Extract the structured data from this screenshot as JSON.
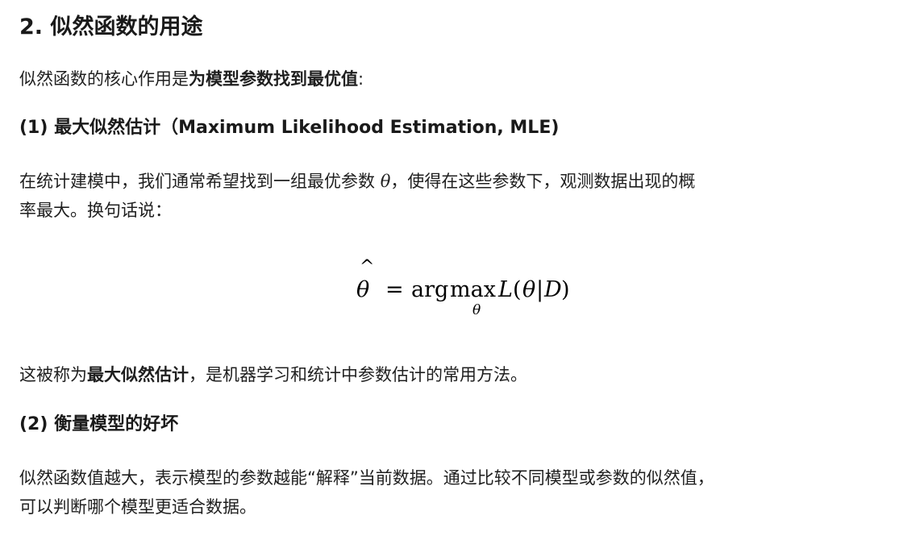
{
  "section_title": "2. 似然函数的用途",
  "intro": {
    "text": "似然函数的核心作用是",
    "bold": "为模型参数找到最优值",
    "colon": ":"
  },
  "subsection1": {
    "title": "(1) 最大似然估计（Maximum Likelihood Estimation, MLE)",
    "para_line1_before": "在统计建模中，我们通常希望找到一组最优参数 ",
    "theta_symbol": "θ",
    "para_line1_after": "，使得在这些参数下，观测数据出现的概",
    "para_line2": "率最大。换句话说："
  },
  "formula": {
    "lhs": "θ",
    "hat": "^",
    "equals": "=",
    "op_arg": "arg",
    "op_max": "max",
    "subscript": "θ",
    "func": "L",
    "open_paren": "(",
    "arg_theta": "θ",
    "bar": "|",
    "arg_data": "D",
    "close_paren": ")"
  },
  "mle_note": {
    "before": "这被称为",
    "bold": "最大似然估计",
    "after": "，是机器学习和统计中参数估计的常用方法。"
  },
  "subsection2": {
    "title": "(2) 衡量模型的好坏",
    "para_line1": "似然函数值越大，表示模型的参数越能“解释”当前数据。通过比较不同模型或参数的似然值，",
    "para_line2": "可以判断哪个模型更适合数据。"
  }
}
